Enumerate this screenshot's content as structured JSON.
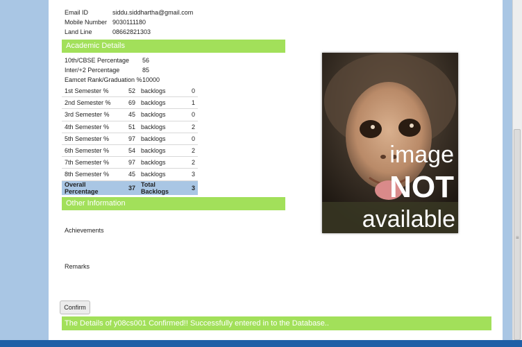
{
  "contact": {
    "email_label": "Email ID",
    "email": "siddu.siddhartha@gmail.com",
    "mobile_label": "Mobile Number",
    "mobile": "9030111180",
    "landline_label": "Land Line",
    "landline": "08662821303"
  },
  "academic": {
    "title": "Academic Details",
    "scores": [
      {
        "label": "10th/CBSE Percentage",
        "value": "56"
      },
      {
        "label": "Inter/+2 Percentage",
        "value": "85"
      },
      {
        "label": "Eamcet Rank/Graduation %",
        "value": "10000"
      }
    ],
    "semesters": [
      {
        "label": "1st Semester %",
        "percent": "52",
        "backlog_label": "backlogs",
        "backlogs": "0"
      },
      {
        "label": "2nd Semester %",
        "percent": "69",
        "backlog_label": "backlogs",
        "backlogs": "1"
      },
      {
        "label": "3rd Semester %",
        "percent": "45",
        "backlog_label": "backlogs",
        "backlogs": "0"
      },
      {
        "label": "4th Semester %",
        "percent": "51",
        "backlog_label": "backlogs",
        "backlogs": "2"
      },
      {
        "label": "5th Semester %",
        "percent": "97",
        "backlog_label": "backlogs",
        "backlogs": "0"
      },
      {
        "label": "6th Semester %",
        "percent": "54",
        "backlog_label": "backlogs",
        "backlogs": "2"
      },
      {
        "label": "7th Semester %",
        "percent": "97",
        "backlog_label": "backlogs",
        "backlogs": "2"
      },
      {
        "label": "8th Semester %",
        "percent": "45",
        "backlog_label": "backlogs",
        "backlogs": "3"
      }
    ],
    "overall": {
      "label": "Overall Percentage",
      "percent": "37",
      "backlog_label": "Total Backlogs",
      "backlogs": "3"
    }
  },
  "other": {
    "title": "Other Information",
    "achievements_label": "Achievements",
    "remarks_label": "Remarks"
  },
  "photo": {
    "line1": "image",
    "line2": "NOT",
    "line3": "available"
  },
  "confirm_label": "Confirm",
  "success_message": "The Details of y08cs001 Confirmed!! Successfully entered in to the Database..",
  "colors": {
    "section_bar": "#a2e05a",
    "page_bg": "#a9c6e4",
    "bottom_bar": "#1f5fa6"
  }
}
